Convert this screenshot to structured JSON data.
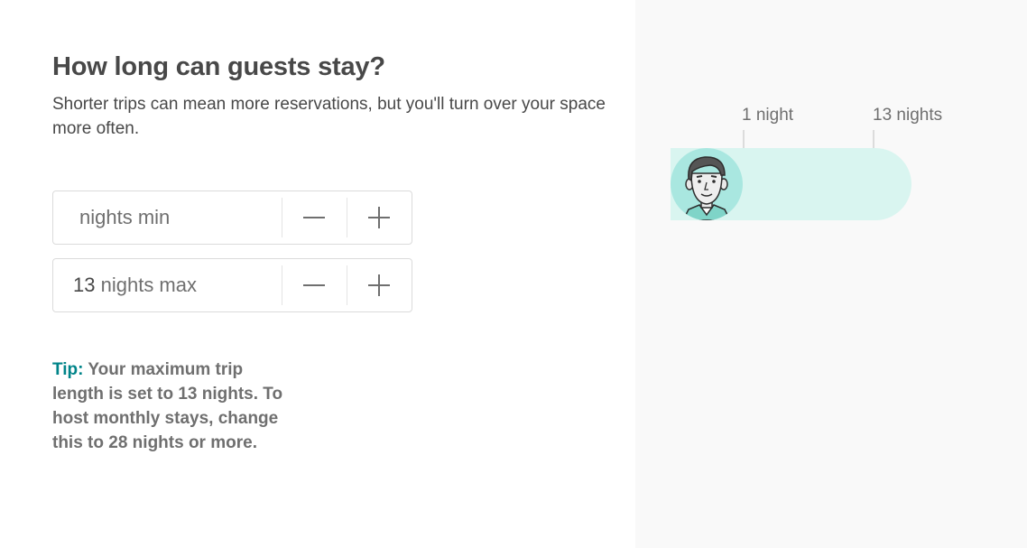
{
  "header": {
    "title": "How long can guests stay?",
    "subtitle": "Shorter trips can mean more reservations, but you'll turn over your space more often."
  },
  "min_stepper": {
    "value": "",
    "unit": "nights min",
    "decrement_icon": "minus-icon",
    "increment_icon": "plus-icon"
  },
  "max_stepper": {
    "value": "13",
    "unit": "nights max",
    "decrement_icon": "minus-icon",
    "increment_icon": "plus-icon"
  },
  "tip": {
    "label": "Tip:",
    "text": "Your maximum trip length is set to 13 nights. To host monthly stays, change this to 28 nights or more."
  },
  "illustration": {
    "min_label": "1 night",
    "max_label": "13 nights",
    "bar_color": "#d9f5f0",
    "avatar_icon": "guest-avatar-icon"
  },
  "colors": {
    "accent": "#008489",
    "text": "#484848",
    "muted": "#6f6f6f",
    "border": "#dbdbdb"
  }
}
